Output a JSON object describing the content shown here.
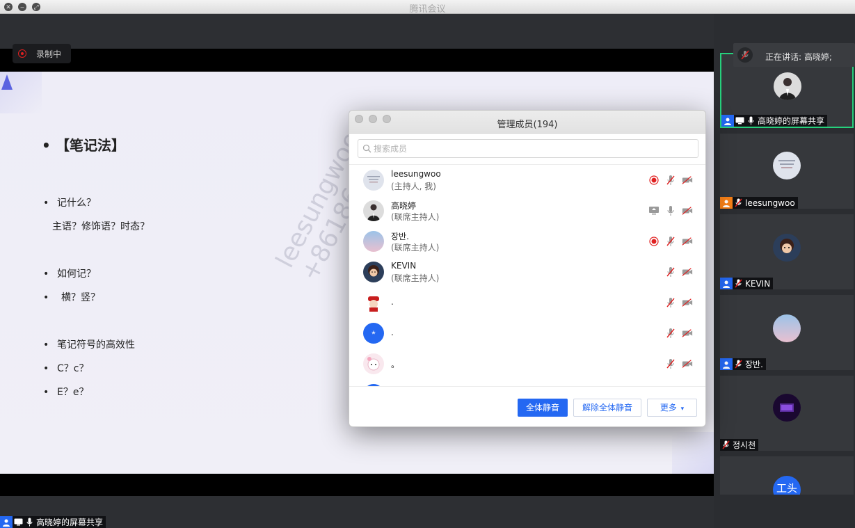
{
  "window": {
    "title": "腾讯会议"
  },
  "recording": {
    "label": "录制中"
  },
  "slide": {
    "title": "【笔记法】",
    "lines": [
      "记什么？",
      "主语？修饰语？时态？",
      "如何记？",
      "横？竖？",
      "笔记符号的高效性",
      "C？c？",
      "E？e？"
    ],
    "watermark_name": "leesungwoo",
    "watermark_phone": "+86186"
  },
  "bottom_tag": {
    "label": "高晓婷的屏幕共享"
  },
  "speaking": {
    "text": "正在讲话: 高晓婷;"
  },
  "tiles": [
    {
      "name": "高晓婷的屏幕共享",
      "role": "host"
    },
    {
      "name": "leesungwoo",
      "role": "host"
    },
    {
      "name": "KEVIN",
      "role": "cohost"
    },
    {
      "name": "장반.",
      "role": "cohost"
    },
    {
      "name": "정시천",
      "role": "member"
    },
    {
      "name": "",
      "initials": "工头",
      "role": "member"
    }
  ],
  "dialog": {
    "title": "管理成员(194)",
    "search_placeholder": "搜索成员",
    "members": [
      {
        "name": "leesungwoo",
        "role": "(主持人, 我)",
        "recording": true,
        "sharing": false,
        "mic_muted": true,
        "video_off": true
      },
      {
        "name": "高晓婷",
        "role": "(联席主持人)",
        "recording": false,
        "sharing": true,
        "mic_muted": false,
        "video_off": true
      },
      {
        "name": "장반.",
        "role": "(联席主持人)",
        "recording": true,
        "sharing": false,
        "mic_muted": true,
        "video_off": true
      },
      {
        "name": "KEVIN",
        "role": "(联席主持人)",
        "recording": false,
        "sharing": false,
        "mic_muted": true,
        "video_off": true
      },
      {
        "name": ".",
        "role": "",
        "recording": false,
        "sharing": false,
        "mic_muted": true,
        "video_off": true
      },
      {
        "name": ".",
        "role": "",
        "recording": false,
        "sharing": false,
        "mic_muted": true,
        "video_off": true
      },
      {
        "name": "。",
        "role": "",
        "recording": false,
        "sharing": false,
        "mic_muted": true,
        "video_off": true
      }
    ],
    "buttons": {
      "mute_all": "全体静音",
      "unmute_all": "解除全体静音",
      "more": "更多"
    },
    "more_caret": "▾"
  },
  "colors": {
    "accent": "#2468f2",
    "active_border": "#26d07c",
    "record_red": "#e02020"
  }
}
